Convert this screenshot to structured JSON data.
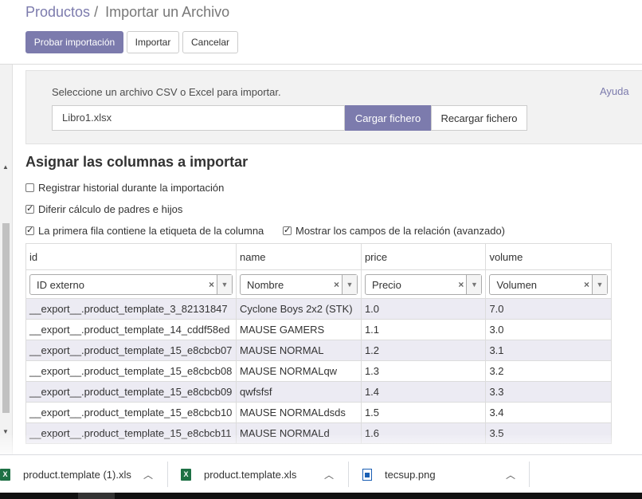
{
  "breadcrumb": {
    "parent": "Productos",
    "separator": "/",
    "current": "Importar un Archivo"
  },
  "toolbar": {
    "test_label": "Probar importación",
    "import_label": "Importar",
    "cancel_label": "Cancelar"
  },
  "upload": {
    "hint": "Seleccione un archivo CSV o Excel para importar.",
    "help": "Ayuda",
    "file_name": "Libro1.xlsx",
    "load_label": "Cargar fichero",
    "reload_label": "Recargar fichero"
  },
  "mapping": {
    "title": "Asignar las columnas a importar",
    "options": [
      {
        "label": "Registrar historial durante la importación",
        "checked": false
      },
      {
        "label": "Diferir cálculo de padres e hijos",
        "checked": true
      },
      {
        "label": "La primera fila contiene la etiqueta de la columna",
        "checked": true
      },
      {
        "label": "Mostrar los campos de la relación (avanzado)",
        "checked": true
      }
    ],
    "columns": [
      {
        "header": "id",
        "field": "ID externo"
      },
      {
        "header": "name",
        "field": "Nombre"
      },
      {
        "header": "price",
        "field": "Precio"
      },
      {
        "header": "volume",
        "field": "Volumen"
      }
    ],
    "rows": [
      [
        "__export__.product_template_3_82131847",
        "Cyclone Boys 2x2 (STK)",
        "1.0",
        "7.0"
      ],
      [
        "__export__.product_template_14_cddf58ed",
        "MAUSE GAMERS",
        "1.1",
        "3.0"
      ],
      [
        "__export__.product_template_15_e8cbcb07",
        "MAUSE NORMAL",
        "1.2",
        "3.1"
      ],
      [
        "__export__.product_template_15_e8cbcb08",
        "MAUSE NORMALqw",
        "1.3",
        "3.2"
      ],
      [
        "__export__.product_template_15_e8cbcb09",
        "qwfsfsf",
        "1.4",
        "3.3"
      ],
      [
        "__export__.product_template_15_e8cbcb10",
        "MAUSE NORMALdsds",
        "1.5",
        "3.4"
      ],
      [
        "__export__.product_template_15_e8cbcb11",
        "MAUSE NORMALd",
        "1.6",
        "3.5"
      ]
    ],
    "clear_glyph": "×",
    "caret_glyph": "▼"
  },
  "downloads": [
    {
      "name": "product.template (1).xls",
      "icon": "excel-file-icon"
    },
    {
      "name": "product.template.xls",
      "icon": "excel-file-icon"
    },
    {
      "name": "tecsup.png",
      "icon": "image-file-icon"
    }
  ],
  "colors": {
    "accent": "#7c7bad",
    "row_alt": "#ecebf3",
    "panel": "#f2f2f2"
  }
}
